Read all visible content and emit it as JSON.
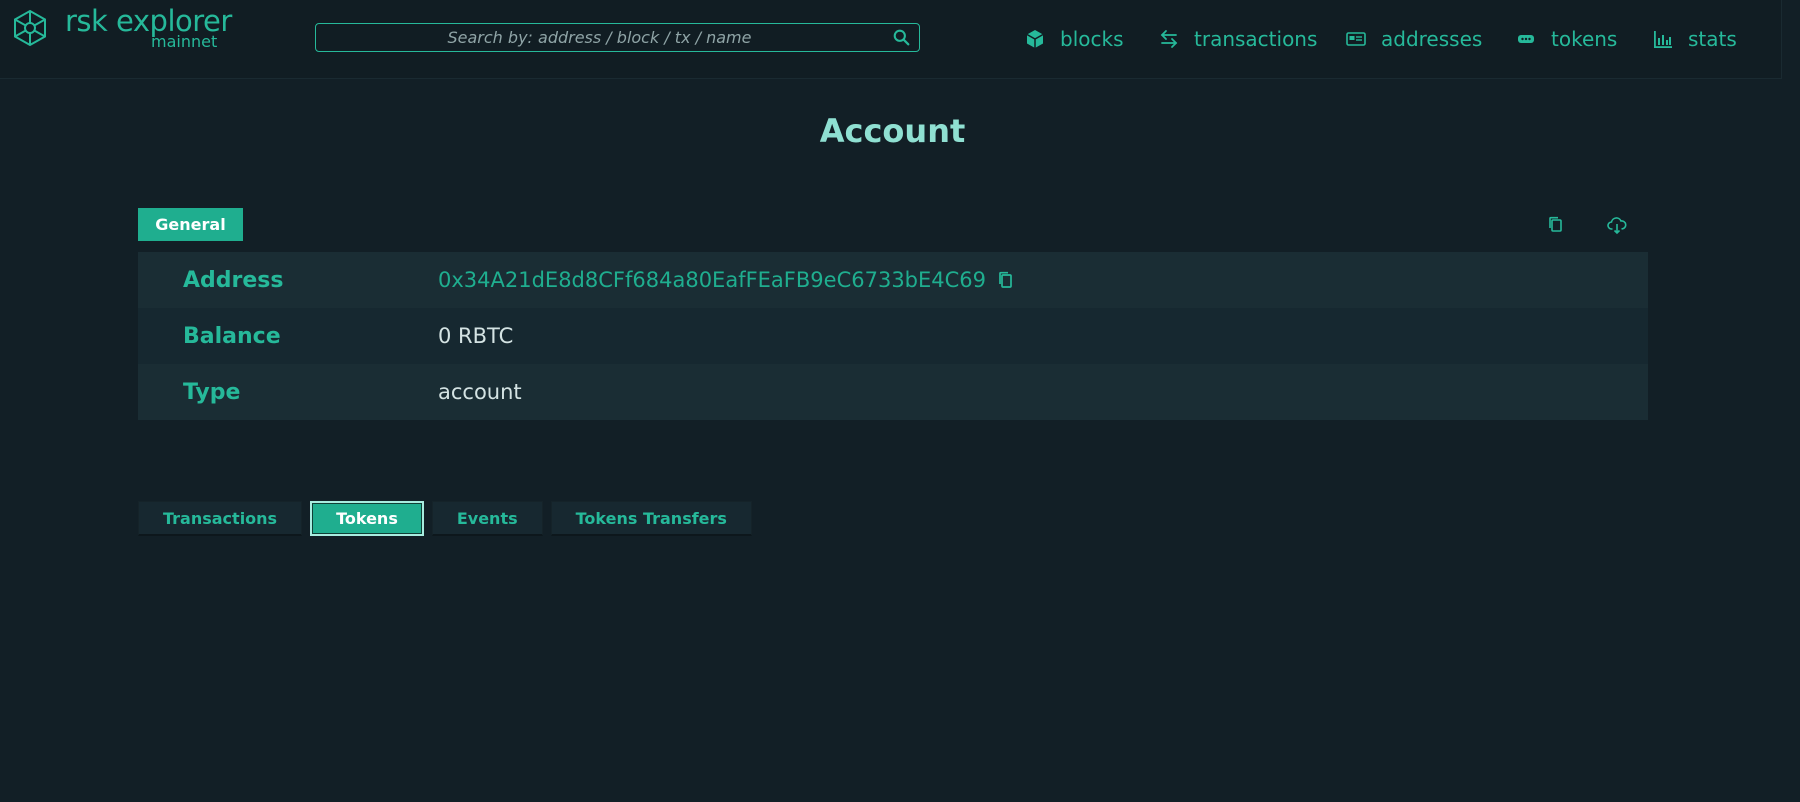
{
  "header": {
    "brand_title": "rsk explorer",
    "brand_subtitle": "mainnet",
    "search_placeholder": "Search by: address / block / tx / name",
    "nav": [
      {
        "label": "blocks",
        "icon": "cube-icon"
      },
      {
        "label": "transactions",
        "icon": "arrows-exchange-icon"
      },
      {
        "label": "addresses",
        "icon": "id-card-icon"
      },
      {
        "label": "tokens",
        "icon": "token-icon"
      },
      {
        "label": "stats",
        "icon": "bar-chart-icon"
      }
    ]
  },
  "page": {
    "title": "Account",
    "general_tab": "General",
    "tools": [
      {
        "icon": "copy-icon"
      },
      {
        "icon": "cloud-download-icon"
      }
    ]
  },
  "details": [
    {
      "key": "Address",
      "value": "0x34A21dE8d8CFf684a80EafFEaFB9eC6733bE4C69"
    },
    {
      "key": "Balance",
      "value": "0 RBTC"
    },
    {
      "key": "Type",
      "value": "account"
    }
  ],
  "tabs": {
    "items": [
      "Transactions",
      "Tokens",
      "Events",
      "Tokens Transfers"
    ],
    "active": "Tokens"
  },
  "colors": {
    "accent": "#26b99a",
    "background": "#121f26",
    "title": "#8fe0d2"
  }
}
